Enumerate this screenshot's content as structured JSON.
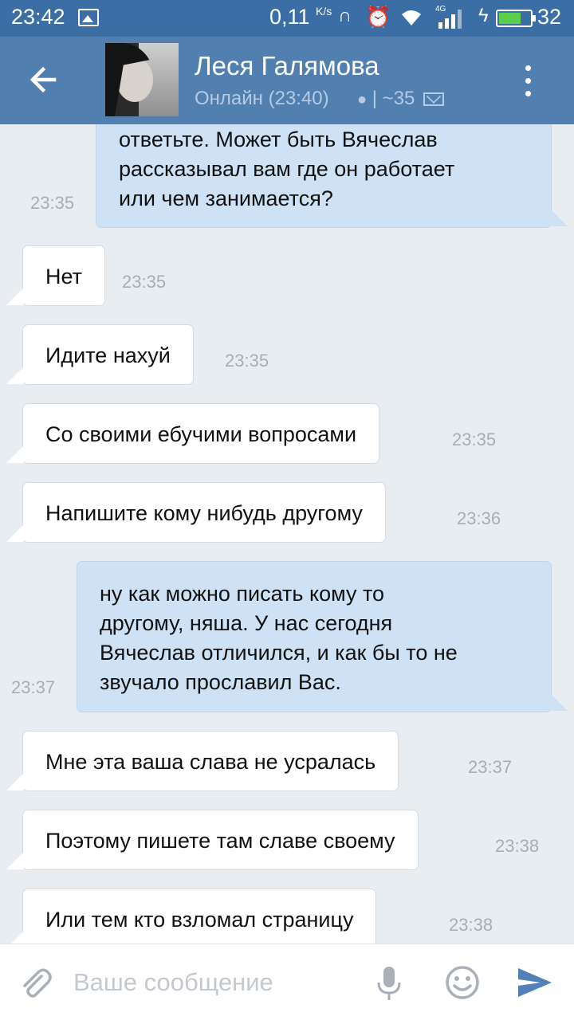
{
  "status_bar": {
    "time": "23:42",
    "speed": "0,11",
    "speed_unit": "K/s",
    "network": "4G",
    "battery_level": "32",
    "battery_fraction": 0.72,
    "icons": [
      "image-icon",
      "headset-icon",
      "alarm-icon",
      "wifi-icon",
      "signal-icon",
      "charging-icon",
      "battery-icon"
    ]
  },
  "header": {
    "back_icon": "arrow-left-icon",
    "contact_name": "Леся Галямова",
    "online_status": "Онлайн (23:40)",
    "separator": "|",
    "sticker_count": "~35",
    "device_icon": "apple-icon",
    "mail_icon": "envelope-icon",
    "menu_icon": "more-vertical-icon"
  },
  "messages": [
    {
      "dir": "out",
      "lines": [
        "ответьте. Может быть Вячеслав",
        "рассказывал вам где он работает",
        "или чем занимается?"
      ],
      "time": "23:35"
    },
    {
      "dir": "in",
      "text": "Нет",
      "time": "23:35"
    },
    {
      "dir": "in",
      "text": "Идите нахуй",
      "time": "23:35"
    },
    {
      "dir": "in",
      "text": "Со своими ебучими вопросами",
      "time": "23:35"
    },
    {
      "dir": "in",
      "text": "Напишите кому нибудь другому",
      "time": "23:36"
    },
    {
      "dir": "out",
      "lines": [
        "ну как можно писать кому то",
        "другому, няша. У нас сегодня",
        "Вячеслав отличился, и как бы то не",
        "звучало прославил Вас."
      ],
      "time": "23:37"
    },
    {
      "dir": "in",
      "text": "Мне эта ваша слава не усралась",
      "time": "23:37"
    },
    {
      "dir": "in",
      "text": "Поэтому пишете там славе своему",
      "time": "23:38"
    },
    {
      "dir": "in",
      "text": "Или тем кто взломал страницу",
      "time": "23:38"
    }
  ],
  "composer": {
    "placeholder": "Ваше сообщение",
    "attach_icon": "paperclip-icon",
    "mic_icon": "microphone-icon",
    "emoji_icon": "smiley-icon",
    "send_icon": "send-icon"
  },
  "colors": {
    "header": "#517fb0",
    "status_bar": "#3a6ea5",
    "background": "#e8edf2",
    "incoming_bubble": "#ffffff",
    "outgoing_bubble": "#cfe2f5",
    "send_accent": "#5181b8"
  }
}
